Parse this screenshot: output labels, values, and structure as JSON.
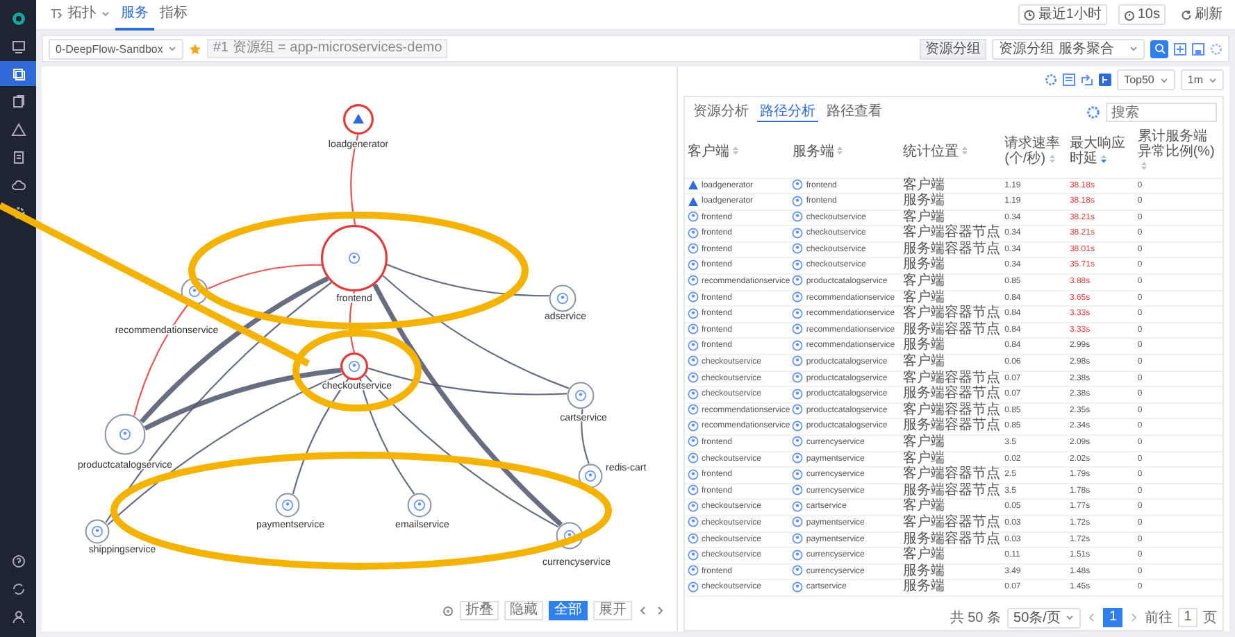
{
  "sidebar": {
    "items": [
      {
        "kind": "monitor",
        "selected": false
      },
      {
        "kind": "layers",
        "selected": true
      },
      {
        "kind": "copy",
        "selected": false
      },
      {
        "kind": "warning",
        "selected": false
      },
      {
        "kind": "document",
        "selected": false
      },
      {
        "kind": "cloud",
        "selected": false
      },
      {
        "kind": "gear",
        "selected": false
      },
      {
        "kind": "help",
        "selected": false
      },
      {
        "kind": "sync",
        "selected": false
      },
      {
        "kind": "user",
        "selected": false
      }
    ]
  },
  "topbar": {
    "menu": "拓扑",
    "tabs": [
      {
        "label": "服务",
        "selected": true
      },
      {
        "label": "指标",
        "selected": false
      }
    ],
    "time_range": "最近1小时",
    "interval": "10s",
    "refresh": "刷新"
  },
  "filter": {
    "team": "0-DeepFlow-Sandbox",
    "starred": true,
    "tag": "#1 资源组 = app-microservices-demo",
    "group_label": "资源分组",
    "group_value": "资源分组 服务聚合"
  },
  "toolbar": {
    "top": "Top50",
    "interval": "1m"
  },
  "graph": {
    "nodes": [
      {
        "name": "loadgenerator",
        "kind": "generator",
        "error": true
      },
      {
        "name": "frontend",
        "kind": "service",
        "error": true
      },
      {
        "name": "recommendationservice",
        "kind": "service",
        "error": false
      },
      {
        "name": "adservice",
        "kind": "service",
        "error": false
      },
      {
        "name": "checkoutservice",
        "kind": "service",
        "error": true
      },
      {
        "name": "cartservice",
        "kind": "service",
        "error": false
      },
      {
        "name": "productcatalogservice",
        "kind": "service",
        "error": false
      },
      {
        "name": "redis-cart",
        "kind": "service",
        "error": false
      },
      {
        "name": "paymentservice",
        "kind": "service",
        "error": false
      },
      {
        "name": "emailservice",
        "kind": "service",
        "error": false
      },
      {
        "name": "shippingservice",
        "kind": "service",
        "error": false
      },
      {
        "name": "currencyservice",
        "kind": "service",
        "error": false
      }
    ],
    "edges": [
      {
        "error": true
      },
      {
        "error": true
      },
      {
        "error": true
      },
      {
        "error": false
      },
      {
        "error": false
      },
      {
        "error": false
      },
      {
        "error": false
      },
      {
        "error": false
      },
      {
        "error": true
      },
      {
        "error": false
      },
      {
        "error": false
      },
      {
        "error": false
      },
      {
        "error": false
      },
      {
        "error": false
      },
      {
        "error": false
      },
      {
        "error": false
      }
    ],
    "controls": [
      {
        "label": "折叠",
        "selected": false
      },
      {
        "label": "隐藏",
        "selected": false
      },
      {
        "label": "全部",
        "selected": true
      },
      {
        "label": "展开",
        "selected": false
      }
    ]
  },
  "panel": {
    "tabs": [
      {
        "label": "资源分析",
        "selected": false
      },
      {
        "label": "路径分析",
        "selected": true
      },
      {
        "label": "路径查看",
        "selected": false
      }
    ],
    "search": {
      "placeholder": "搜索"
    },
    "columns": [
      {
        "label": "客户端",
        "sorted": false
      },
      {
        "label": "服务端",
        "sorted": false
      },
      {
        "label": "统计位置",
        "sorted": false
      },
      {
        "label": "请求速率(个/秒)",
        "sorted": false
      },
      {
        "label": "最大响应时延",
        "sorted": true
      },
      {
        "label": "累计服务端异常比例(%)",
        "sorted": false
      }
    ],
    "rows": [
      {
        "client": "loadgenerator",
        "client_generator": true,
        "server": "frontend",
        "position": "客户端",
        "rate": "1.19",
        "latency": "38.18s",
        "alert": true,
        "error_ratio": "0"
      },
      {
        "client": "loadgenerator",
        "client_generator": true,
        "server": "frontend",
        "position": "服务端",
        "rate": "1.19",
        "latency": "38.18s",
        "alert": true,
        "error_ratio": "0"
      },
      {
        "client": "frontend",
        "client_generator": false,
        "server": "checkoutservice",
        "position": "客户端",
        "rate": "0.34",
        "latency": "38.21s",
        "alert": true,
        "error_ratio": "0"
      },
      {
        "client": "frontend",
        "client_generator": false,
        "server": "checkoutservice",
        "position": "客户端容器节点",
        "rate": "0.34",
        "latency": "38.21s",
        "alert": true,
        "error_ratio": "0"
      },
      {
        "client": "frontend",
        "client_generator": false,
        "server": "checkoutservice",
        "position": "服务端容器节点",
        "rate": "0.34",
        "latency": "38.01s",
        "alert": true,
        "error_ratio": "0"
      },
      {
        "client": "frontend",
        "client_generator": false,
        "server": "checkoutservice",
        "position": "服务端",
        "rate": "0.34",
        "latency": "35.71s",
        "alert": true,
        "error_ratio": "0"
      },
      {
        "client": "recommendationservice",
        "client_generator": false,
        "server": "productcatalogservice",
        "position": "客户端",
        "rate": "0.85",
        "latency": "3.88s",
        "alert": true,
        "error_ratio": "0"
      },
      {
        "client": "frontend",
        "client_generator": false,
        "server": "recommendationservice",
        "position": "客户端",
        "rate": "0.84",
        "latency": "3.65s",
        "alert": true,
        "error_ratio": "0"
      },
      {
        "client": "frontend",
        "client_generator": false,
        "server": "recommendationservice",
        "position": "客户端容器节点",
        "rate": "0.84",
        "latency": "3.33s",
        "alert": true,
        "error_ratio": "0"
      },
      {
        "client": "frontend",
        "client_generator": false,
        "server": "recommendationservice",
        "position": "服务端容器节点",
        "rate": "0.84",
        "latency": "3.33s",
        "alert": true,
        "error_ratio": "0"
      },
      {
        "client": "frontend",
        "client_generator": false,
        "server": "recommendationservice",
        "position": "服务端",
        "rate": "0.84",
        "latency": "2.99s",
        "alert": false,
        "error_ratio": "0"
      },
      {
        "client": "checkoutservice",
        "client_generator": false,
        "server": "productcatalogservice",
        "position": "客户端",
        "rate": "0.06",
        "latency": "2.98s",
        "alert": false,
        "error_ratio": "0"
      },
      {
        "client": "checkoutservice",
        "client_generator": false,
        "server": "productcatalogservice",
        "position": "客户端容器节点",
        "rate": "0.07",
        "latency": "2.38s",
        "alert": false,
        "error_ratio": "0"
      },
      {
        "client": "checkoutservice",
        "client_generator": false,
        "server": "productcatalogservice",
        "position": "服务端容器节点",
        "rate": "0.07",
        "latency": "2.38s",
        "alert": false,
        "error_ratio": "0"
      },
      {
        "client": "recommendationservice",
        "client_generator": false,
        "server": "productcatalogservice",
        "position": "客户端容器节点",
        "rate": "0.85",
        "latency": "2.35s",
        "alert": false,
        "error_ratio": "0"
      },
      {
        "client": "recommendationservice",
        "client_generator": false,
        "server": "productcatalogservice",
        "position": "服务端容器节点",
        "rate": "0.85",
        "latency": "2.34s",
        "alert": false,
        "error_ratio": "0"
      },
      {
        "client": "frontend",
        "client_generator": false,
        "server": "currencyservice",
        "position": "客户端",
        "rate": "3.5",
        "latency": "2.09s",
        "alert": false,
        "error_ratio": "0"
      },
      {
        "client": "checkoutservice",
        "client_generator": false,
        "server": "paymentservice",
        "position": "客户端",
        "rate": "0.02",
        "latency": "2.02s",
        "alert": false,
        "error_ratio": "0"
      },
      {
        "client": "frontend",
        "client_generator": false,
        "server": "currencyservice",
        "position": "客户端容器节点",
        "rate": "2.5",
        "latency": "1.79s",
        "alert": false,
        "error_ratio": "0"
      },
      {
        "client": "frontend",
        "client_generator": false,
        "server": "currencyservice",
        "position": "服务端容器节点",
        "rate": "3.5",
        "latency": "1.78s",
        "alert": false,
        "error_ratio": "0"
      },
      {
        "client": "checkoutservice",
        "client_generator": false,
        "server": "cartservice",
        "position": "客户端",
        "rate": "0.05",
        "latency": "1.77s",
        "alert": false,
        "error_ratio": "0"
      },
      {
        "client": "checkoutservice",
        "client_generator": false,
        "server": "paymentservice",
        "position": "客户端容器节点",
        "rate": "0.03",
        "latency": "1.72s",
        "alert": false,
        "error_ratio": "0"
      },
      {
        "client": "checkoutservice",
        "client_generator": false,
        "server": "paymentservice",
        "position": "服务端容器节点",
        "rate": "0.03",
        "latency": "1.72s",
        "alert": false,
        "error_ratio": "0"
      },
      {
        "client": "checkoutservice",
        "client_generator": false,
        "server": "currencyservice",
        "position": "客户端",
        "rate": "0.11",
        "latency": "1.51s",
        "alert": false,
        "error_ratio": "0"
      },
      {
        "client": "frontend",
        "client_generator": false,
        "server": "currencyservice",
        "position": "服务端",
        "rate": "3.49",
        "latency": "1.48s",
        "alert": false,
        "error_ratio": "0"
      },
      {
        "client": "checkoutservice",
        "client_generator": false,
        "server": "cartservice",
        "position": "服务端",
        "rate": "0.07",
        "latency": "1.45s",
        "alert": false,
        "error_ratio": "0"
      }
    ]
  },
  "pagination": {
    "total": "共 50 条",
    "page_size": "50条/页",
    "pages": [
      {
        "label": "1",
        "selected": true
      }
    ],
    "goto": "前往",
    "goto_value": "1",
    "page_unit": "页"
  },
  "annotations": [
    {
      "kind": "ellipse"
    },
    {
      "kind": "ellipse"
    },
    {
      "kind": "ellipse"
    },
    {
      "kind": "line"
    }
  ]
}
